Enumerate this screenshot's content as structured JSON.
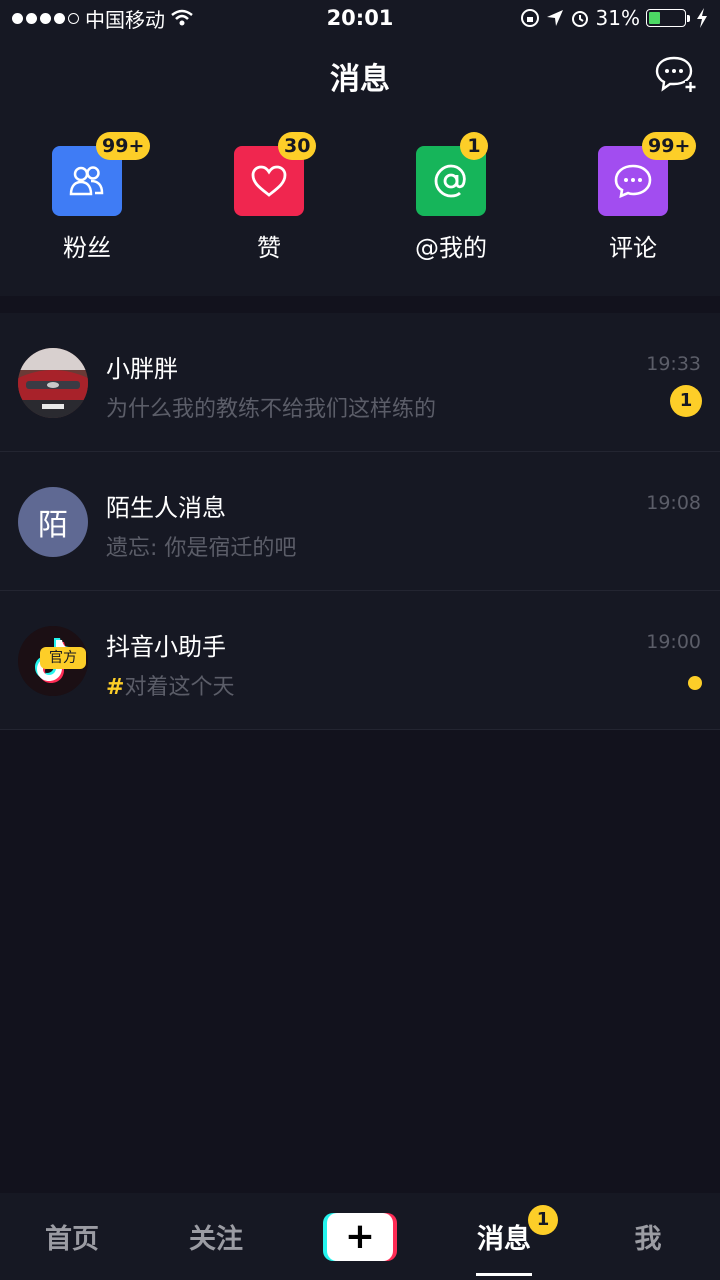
{
  "status_bar": {
    "carrier": "中国移动",
    "time": "20:01",
    "battery": "31%",
    "battery_level": 0.31
  },
  "header": {
    "title": "消息",
    "new_chat_icon": "chat-plus-icon"
  },
  "categories": [
    {
      "label": "粉丝",
      "badge": "99+",
      "icon": "fans-icon",
      "color": "#3f7cf5"
    },
    {
      "label": "赞",
      "badge": "30",
      "icon": "heart-icon",
      "color": "#f0264f"
    },
    {
      "label": "@我的",
      "badge": "1",
      "icon": "at-icon",
      "color": "#16b55a"
    },
    {
      "label": "评论",
      "badge": "99+",
      "icon": "comment-icon",
      "color": "#a24df0"
    }
  ],
  "messages": [
    {
      "name": "小胖胖",
      "preview": "为什么我的教练不给我们这样练的",
      "time": "19:33",
      "unread": "1"
    },
    {
      "name": "陌生人消息",
      "preview": "遗忘: 你是宿迁的吧",
      "time": "19:08",
      "avatar_char": "陌"
    },
    {
      "name": "抖音小助手",
      "preview_hash": "#",
      "preview": "对着这个天",
      "time": "19:00",
      "tag": "官方"
    }
  ],
  "tab_bar": {
    "tabs": [
      "首页",
      "关注",
      "消息",
      "我"
    ],
    "create_label": "+",
    "message_badge": "1",
    "active": "消息"
  }
}
